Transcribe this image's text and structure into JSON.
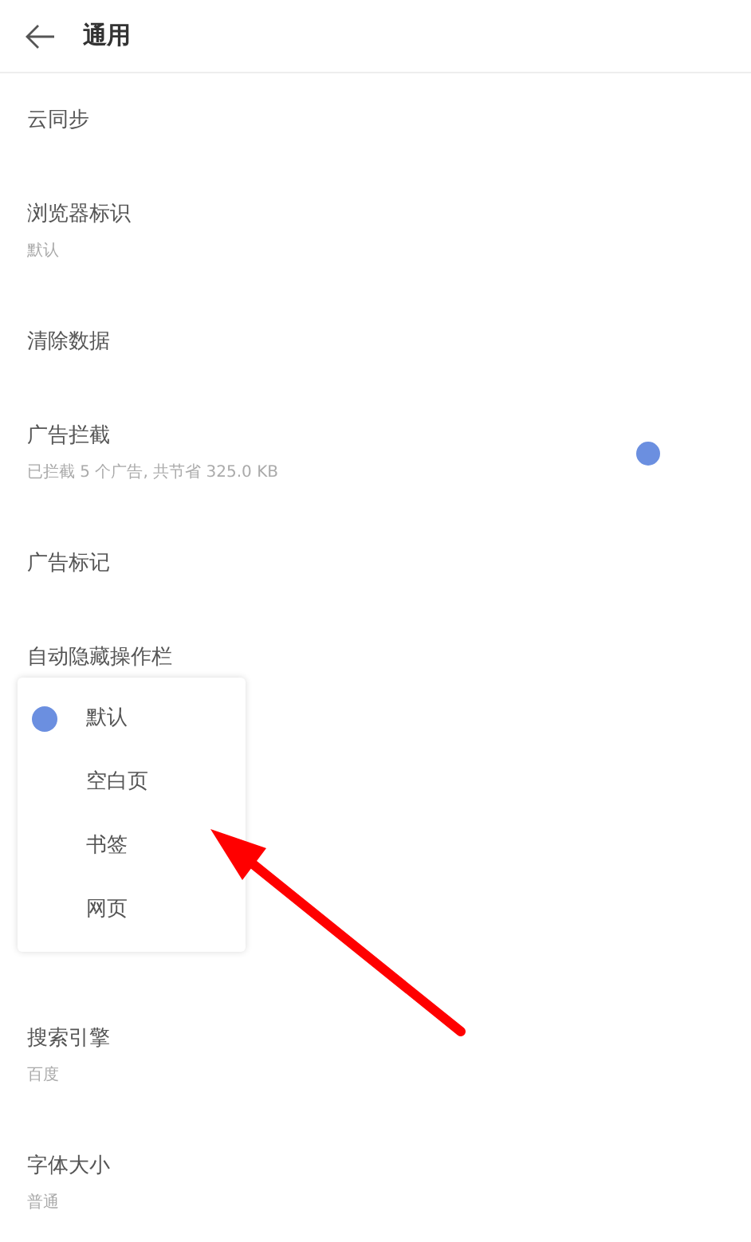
{
  "header": {
    "title": "通用"
  },
  "settings": [
    {
      "title": "云同步"
    },
    {
      "title": "浏览器标识",
      "subtitle": "默认"
    },
    {
      "title": "清除数据"
    },
    {
      "title": "广告拦截",
      "subtitle": "已拦截 5 个广告, 共节省 325.0 KB",
      "kind": "toggle",
      "on": true
    },
    {
      "title": "广告标记"
    },
    {
      "title": "自动隐藏操作栏"
    }
  ],
  "popup_menu": [
    {
      "label": "默认",
      "selected": true
    },
    {
      "label": "空白页",
      "selected": false
    },
    {
      "label": "书签",
      "selected": false
    },
    {
      "label": "网页",
      "selected": false
    }
  ],
  "settings_below": [
    {
      "title": "搜索引擎",
      "subtitle": "百度"
    },
    {
      "title": "字体大小",
      "subtitle": "普通"
    }
  ]
}
